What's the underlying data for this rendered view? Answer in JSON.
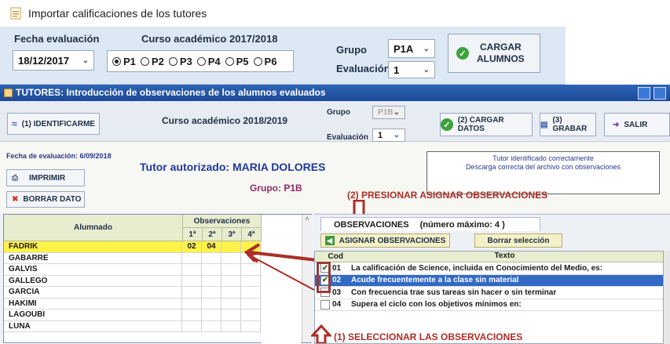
{
  "back_window": {
    "title": "Importar calificaciones de los tutores",
    "fecha_label": "Fecha evaluación",
    "fecha_value": "18/12/2017",
    "curso_label": "Curso académico 2017/2018",
    "periods": [
      "P1",
      "P2",
      "P3",
      "P4",
      "P5",
      "P6"
    ],
    "selected_period": "P1",
    "grupo_label": "Grupo",
    "grupo_value": "P1A",
    "evaluacion_label": "Evaluación",
    "evaluacion_value": "1",
    "cargar_line1": "CARGAR",
    "cargar_line2": "ALUMNOS"
  },
  "front_window": {
    "title": "TUTORES: Introducción de observaciones de los alumnos evaluados",
    "identificarme": "(1) IDENTIFICARME",
    "curso": "Curso académico 2018/2019",
    "grupo_label": "Grupo",
    "grupo_value": "P1B",
    "evaluacion_label": "Evaluación",
    "evaluacion_value": "1",
    "cargar_datos": "(2) CARGAR DATOS",
    "grabar": "(3) GRABAR",
    "salir": "SALIR",
    "fecha_eval": "Fecha de evaluación: 6/09/2018",
    "tutor_auth": "Tutor autorizado: MARIA DOLORES",
    "grupo_line": "Grupo: P1B",
    "imprimir": "IMPRIMIR",
    "borrar_dato": "BORRAR DATO",
    "status_line1": "Tutor identificado correctamente",
    "status_line2": "Descarga correcta del archivo con observaciones"
  },
  "students": {
    "header_name": "Alumnado",
    "header_obs": "Observaciones",
    "obs_cols": [
      "1ª",
      "2ª",
      "3ª",
      "4ª"
    ],
    "rows": [
      {
        "name": "FADRIK",
        "o1": "02",
        "o2": "04",
        "o3": "",
        "o4": ""
      },
      {
        "name": "GABARRE",
        "o1": "",
        "o2": "",
        "o3": "",
        "o4": ""
      },
      {
        "name": "GALVIS",
        "o1": "",
        "o2": "",
        "o3": "",
        "o4": ""
      },
      {
        "name": "GALLEGO",
        "o1": "",
        "o2": "",
        "o3": "",
        "o4": ""
      },
      {
        "name": "GARCIA",
        "o1": "",
        "o2": "",
        "o3": "",
        "o4": ""
      },
      {
        "name": "HAKIMI",
        "o1": "",
        "o2": "",
        "o3": "",
        "o4": ""
      },
      {
        "name": "LAGOUBI",
        "o1": "",
        "o2": "",
        "o3": "",
        "o4": ""
      },
      {
        "name": "LUNA",
        "o1": "",
        "o2": "",
        "o3": "",
        "o4": ""
      }
    ]
  },
  "observations": {
    "tab_label": "OBSERVACIONES",
    "max_label": "(número máximo: 4 )",
    "asignar": "ASIGNAR OBSERVACIONES",
    "borrar_sel": "Borrar selección",
    "col_cod": "Cod",
    "col_texto": "Texto",
    "rows": [
      {
        "checked": false,
        "cod": "01",
        "text": "La calificación de Science, incluida en Conocimiento del Medio, es:"
      },
      {
        "checked": true,
        "cod": "02",
        "text": "Acude frecuentemente a la clase sin material"
      },
      {
        "checked": false,
        "cod": "03",
        "text": "Con frecuencia trae sus tareas sin hacer o  sin terminar"
      },
      {
        "checked": false,
        "cod": "04",
        "text": "Supera el ciclo con los objetivos mínimos en:"
      }
    ]
  },
  "annotations": {
    "step2": "(2) PRESIONAR ASIGNAR OBSERVACIONES",
    "step1": "(1) SELECCIONAR LAS OBSERVACIONES"
  },
  "colors": {
    "annotation": "#ab2e25",
    "selection_yellow": "#fff24a",
    "selection_blue": "#316ac5"
  }
}
